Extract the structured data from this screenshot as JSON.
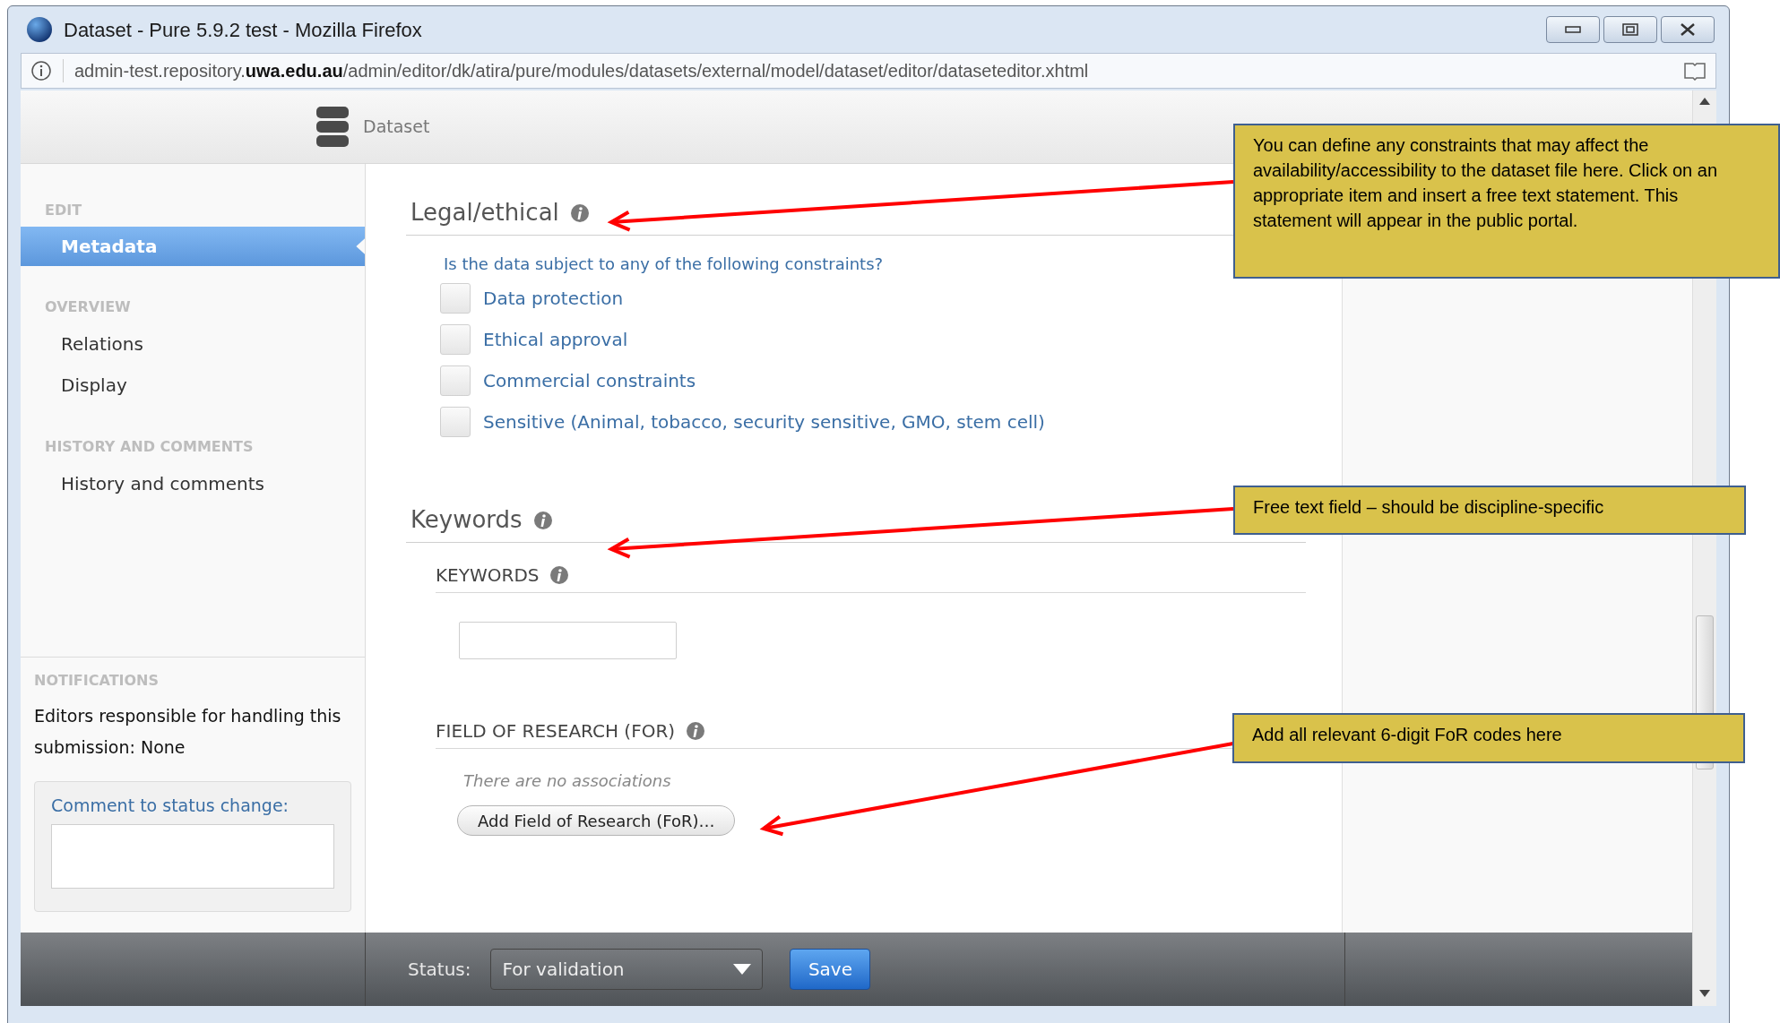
{
  "window": {
    "title": "Dataset - Pure 5.9.2 test - Mozilla Firefox"
  },
  "address_bar": {
    "url": "admin-test.repository.**uwa.edu.au**/admin/editor/dk/atira/pure/modules/datasets/external/model/dataset/editor/dataseteditor.xhtml"
  },
  "header": {
    "title": "Dataset"
  },
  "sidebar": {
    "sections": [
      {
        "heading": "EDIT",
        "items": [
          {
            "label": "Metadata",
            "selected": true
          }
        ]
      },
      {
        "heading": "OVERVIEW",
        "items": [
          {
            "label": "Relations",
            "selected": false
          },
          {
            "label": "Display",
            "selected": false
          }
        ]
      },
      {
        "heading": "HISTORY AND COMMENTS",
        "items": [
          {
            "label": "History and comments",
            "selected": false
          }
        ]
      }
    ]
  },
  "notifications": {
    "heading": "NOTIFICATIONS",
    "text": "Editors responsible for handling this submission: None"
  },
  "comment": {
    "label": "Comment to status change:"
  },
  "legal": {
    "title": "Legal/ethical",
    "question": "Is the data subject to any of the following constraints?",
    "options": [
      {
        "label": "Data protection",
        "checked": false
      },
      {
        "label": "Ethical approval",
        "checked": false
      },
      {
        "label": "Commercial constraints",
        "checked": false
      },
      {
        "label": "Sensitive (Animal, tobacco, security sensitive, GMO, stem cell)",
        "checked": false
      }
    ]
  },
  "keywords": {
    "title": "Keywords",
    "subtitle": "KEYWORDS"
  },
  "field_of_research": {
    "title": "FIELD OF RESEARCH (FOR)",
    "empty_text": "There are no associations",
    "add_button": "Add Field of Research (FoR)…"
  },
  "status_bar": {
    "label": "Status:",
    "value": "For validation",
    "save": "Save"
  },
  "annotations": [
    {
      "text": "You can define any constraints that may affect the availability/accessibility to the dataset file here. Click on an appropriate item and insert a free text statement. This statement will appear in the public portal."
    },
    {
      "text": "Free text field – should be discipline-specific"
    },
    {
      "text": "Add all relevant 6-digit FoR codes here"
    }
  ]
}
